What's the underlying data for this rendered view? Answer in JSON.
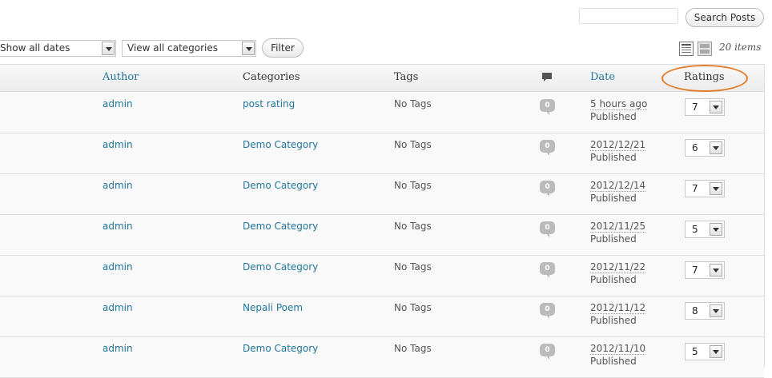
{
  "search": {
    "value": "",
    "button_label": "Search Posts"
  },
  "filters": {
    "dates_selected": "Show all dates",
    "categories_selected": "View all categories",
    "filter_label": "Filter"
  },
  "view_modes": {
    "list_icon": "list-view-icon",
    "excerpt_icon": "excerpt-view-icon"
  },
  "items_count": "20 items",
  "accent_color": "#21759b",
  "highlight_color": "#e57e2a",
  "columns": {
    "author": "Author",
    "categories": "Categories",
    "tags": "Tags",
    "comments_icon": "comment-icon",
    "date": "Date",
    "ratings": "Ratings"
  },
  "rows": [
    {
      "author": "admin",
      "category": "post rating",
      "tags": "No Tags",
      "comments": "0",
      "date": "5 hours ago",
      "status": "Published",
      "rating": "7"
    },
    {
      "author": "admin",
      "category": "Demo Category",
      "tags": "No Tags",
      "comments": "0",
      "date": "2012/12/21",
      "status": "Published",
      "rating": "6"
    },
    {
      "author": "admin",
      "category": "Demo Category",
      "tags": "No Tags",
      "comments": "0",
      "date": "2012/12/14",
      "status": "Published",
      "rating": "7"
    },
    {
      "author": "admin",
      "category": "Demo Category",
      "tags": "No Tags",
      "comments": "0",
      "date": "2012/11/25",
      "status": "Published",
      "rating": "5"
    },
    {
      "author": "admin",
      "category": "Demo Category",
      "tags": "No Tags",
      "comments": "0",
      "date": "2012/11/22",
      "status": "Published",
      "rating": "7"
    },
    {
      "author": "admin",
      "category": "Nepali Poem",
      "tags": "No Tags",
      "comments": "0",
      "date": "2012/11/12",
      "status": "Published",
      "rating": "8"
    },
    {
      "author": "admin",
      "category": "Demo Category",
      "tags": "No Tags",
      "comments": "0",
      "date": "2012/11/10",
      "status": "Published",
      "rating": "5"
    }
  ]
}
